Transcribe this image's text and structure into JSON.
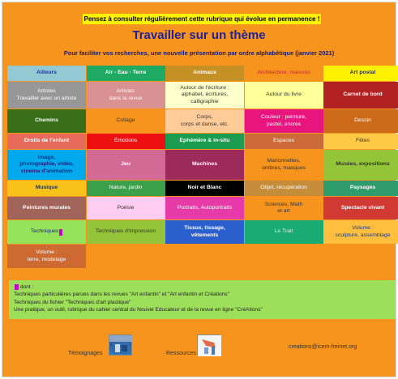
{
  "notice": "Pensez à consulter régulièrement cette rubrique qui évolue en permanence !",
  "title": "Travailler sur un thème",
  "subtitle": "Pour faciliter vos recherches, une nouvelle présentation par ordre alphabétique (janvier 2021)",
  "tiles": [
    {
      "label": "Ailleurs",
      "bg": "#94c9d3",
      "color": "#1a3a8a",
      "bold": true
    },
    {
      "label": "Air - Eau - Terre",
      "bg": "#1eaa63",
      "color": "#ffffff",
      "bold": true
    },
    {
      "label": "Animaux",
      "bg": "#c69124",
      "color": "#ffffff",
      "bold": true
    },
    {
      "label": "Architecture, maisons",
      "bg": "#f7941d",
      "color": "#c62828",
      "bold": false
    },
    {
      "label": "Art postal",
      "bg": "#fff200",
      "color": "#333333",
      "bold": true
    },
    {
      "label": "Artistes\nTravailler avec un artiste",
      "bg": "#979797",
      "color": "#ffffff",
      "bold": false
    },
    {
      "label": "Artistes\ndans la revue",
      "bg": "#d99191",
      "color": "#ffffff",
      "bold": false
    },
    {
      "label": "Autour de l'écriture :\nalphabet, écritures,\ncalligraphie",
      "bg": "#ffffcc",
      "color": "#333333",
      "bold": false
    },
    {
      "label": "Autour du livre",
      "bg": "#ffff99",
      "color": "#333333",
      "bold": false
    },
    {
      "label": "Carnet de bord",
      "bg": "#b22222",
      "color": "#ffffff",
      "bold": true
    },
    {
      "label": "Chemins",
      "bg": "#386e17",
      "color": "#ffffff",
      "bold": true
    },
    {
      "label": "Collage",
      "bg": "#f7941d",
      "color": "#333333",
      "bold": false
    },
    {
      "label": "Corps,\ncorps et danse, etc.",
      "bg": "#ffcc99",
      "color": "#333333",
      "bold": false
    },
    {
      "label": "Couleur : peinture,\npastel, encres",
      "bg": "#e8157f",
      "color": "#ffffff",
      "bold": false
    },
    {
      "label": "Dessin",
      "bg": "#cd6a1a",
      "color": "#ffffff",
      "bold": false
    },
    {
      "label": "Droits de l'enfant",
      "bg": "#e86a5a",
      "color": "#ffffff",
      "bold": true
    },
    {
      "label": "Émotions",
      "bg": "#ee1010",
      "color": "#ffffff",
      "bold": false
    },
    {
      "label": "Ephémère & in-situ",
      "bg": "#1c9c50",
      "color": "#ffffff",
      "bold": true
    },
    {
      "label": "Espaces",
      "bg": "#cc6a3a",
      "color": "#ffffff",
      "bold": false
    },
    {
      "label": "Fêtes",
      "bg": "#ffc845",
      "color": "#333333",
      "bold": false
    },
    {
      "label": "Image,\nphotographie, vidéo,\ncinéma d'animation",
      "bg": "#00a9ec",
      "color": "#1a237e",
      "bold": true
    },
    {
      "label": "Jeu",
      "bg": "#d16b95",
      "color": "#ffffff",
      "bold": true
    },
    {
      "label": "Machines",
      "bg": "#9c2a5b",
      "color": "#ffffff",
      "bold": true
    },
    {
      "label": "Marionnettes,\nombres, masques",
      "bg": "#f7941d",
      "color": "#333333",
      "bold": false
    },
    {
      "label": "Musées, expositions",
      "bg": "#94c43a",
      "color": "#333333",
      "bold": true
    },
    {
      "label": "Musique",
      "bg": "#f7c21a",
      "color": "#333333",
      "bold": true
    },
    {
      "label": "Nature, jardin",
      "bg": "#3aa04a",
      "color": "#ffffff",
      "bold": false
    },
    {
      "label": "Noir et Blanc",
      "bg": "#000000",
      "color": "#ffffff",
      "bold": true
    },
    {
      "label": "Objet, récupération",
      "bg": "#c58c3a",
      "color": "#ffffff",
      "bold": false
    },
    {
      "label": "Paysages",
      "bg": "#2f9c6e",
      "color": "#ffffff",
      "bold": true
    },
    {
      "label": "Peintures murales",
      "bg": "#a0645a",
      "color": "#ffffff",
      "bold": true
    },
    {
      "label": "Poésie",
      "bg": "#ffccf2",
      "color": "#333333",
      "bold": false
    },
    {
      "label": "Portraits, Autoportraits",
      "bg": "#e53aa8",
      "color": "#ffffff",
      "bold": false
    },
    {
      "label": "Sciences, Math\net art",
      "bg": "#f7941d",
      "color": "#333333",
      "bold": false
    },
    {
      "label": "Spectacle vivant",
      "bg": "#d13a33",
      "color": "#ffffff",
      "bold": true
    },
    {
      "label": "Techniques",
      "bg": "#96e25a",
      "color": "#1a237e",
      "bold": false,
      "marker": true
    },
    {
      "label": "Techniques d'impression",
      "bg": "#94c43a",
      "color": "#333333",
      "bold": false
    },
    {
      "label": "Tissus, tissage,\nvêtements",
      "bg": "#2b5fce",
      "color": "#ffffff",
      "bold": true
    },
    {
      "label": "Le Trait",
      "bg": "#18ac72",
      "color": "#e6e6e6",
      "bold": false
    },
    {
      "label": "Volume :\nsculpture, assemblage",
      "bg": "#ffbe3e",
      "color": "#1a3a8a",
      "bold": false
    },
    {
      "label": "Volume :\nterre, modelage",
      "bg": "#cd6a32",
      "color": "#ffffff",
      "bold": false
    }
  ],
  "note": {
    "lines": [
      "dont :",
      "Techniques particulières parues dans les revues \"Art enfantin\" et \"Art enfantin et Créations\"",
      "Techniques du fichier \"Techniques d'art plastique\"",
      "Une pratique, un outil, rubrique du cahier central du Nouvel Educateur et de la revue en ligne \"CréAtions\""
    ]
  },
  "footer": {
    "temoignages": "Témoignages",
    "ressources": "Ressources",
    "email": "creations@icem-freinet.org"
  },
  "colors": {
    "page_bg": "#f7941d",
    "notice_bg": "#fff200",
    "title": "#1f1f9a",
    "note_bg": "#9dde5b",
    "marker": "#c400c4"
  }
}
